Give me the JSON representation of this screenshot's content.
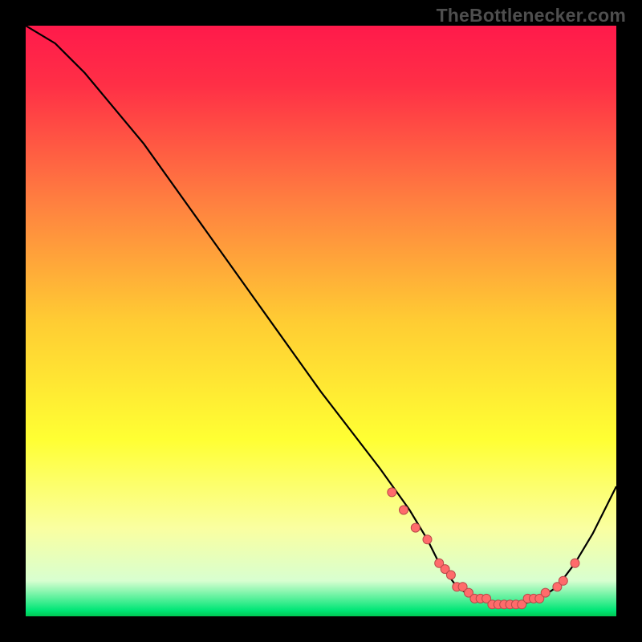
{
  "watermark": "TheBottlenecker.com",
  "colors": {
    "frame": "#000000",
    "gradient_stops": [
      {
        "offset": 0.0,
        "color": "#ff1a4b"
      },
      {
        "offset": 0.1,
        "color": "#ff2f46"
      },
      {
        "offset": 0.3,
        "color": "#ff8040"
      },
      {
        "offset": 0.5,
        "color": "#ffcc33"
      },
      {
        "offset": 0.7,
        "color": "#ffff33"
      },
      {
        "offset": 0.85,
        "color": "#faffa0"
      },
      {
        "offset": 0.94,
        "color": "#d8ffd0"
      },
      {
        "offset": 0.99,
        "color": "#00e676"
      },
      {
        "offset": 1.0,
        "color": "#00c853"
      }
    ],
    "curve": "#000000",
    "dot_fill": "#ff6b6b",
    "dot_ring": "#b94a4a"
  },
  "chart_data": {
    "type": "line",
    "title": "",
    "xlabel": "",
    "ylabel": "",
    "xlim": [
      0,
      100
    ],
    "ylim": [
      0,
      100
    ],
    "series": [
      {
        "name": "bottleneck-curve",
        "x": [
          0,
          5,
          7,
          10,
          20,
          30,
          40,
          50,
          60,
          65,
          68,
          70,
          73,
          76,
          80,
          84,
          87,
          90,
          93,
          96,
          100
        ],
        "y": [
          100,
          97,
          95,
          92,
          80,
          66,
          52,
          38,
          25,
          18,
          13,
          9,
          5,
          3,
          2,
          2,
          3,
          5,
          9,
          14,
          22
        ]
      }
    ],
    "dots": {
      "name": "highlight-dots",
      "x": [
        62,
        64,
        66,
        68,
        70,
        71,
        72,
        73,
        74,
        75,
        76,
        77,
        78,
        79,
        80,
        81,
        82,
        83,
        84,
        85,
        86,
        87,
        88,
        90,
        91,
        93
      ],
      "y": [
        21,
        18,
        15,
        13,
        9,
        8,
        7,
        5,
        5,
        4,
        3,
        3,
        3,
        2,
        2,
        2,
        2,
        2,
        2,
        3,
        3,
        3,
        4,
        5,
        6,
        9
      ]
    }
  }
}
